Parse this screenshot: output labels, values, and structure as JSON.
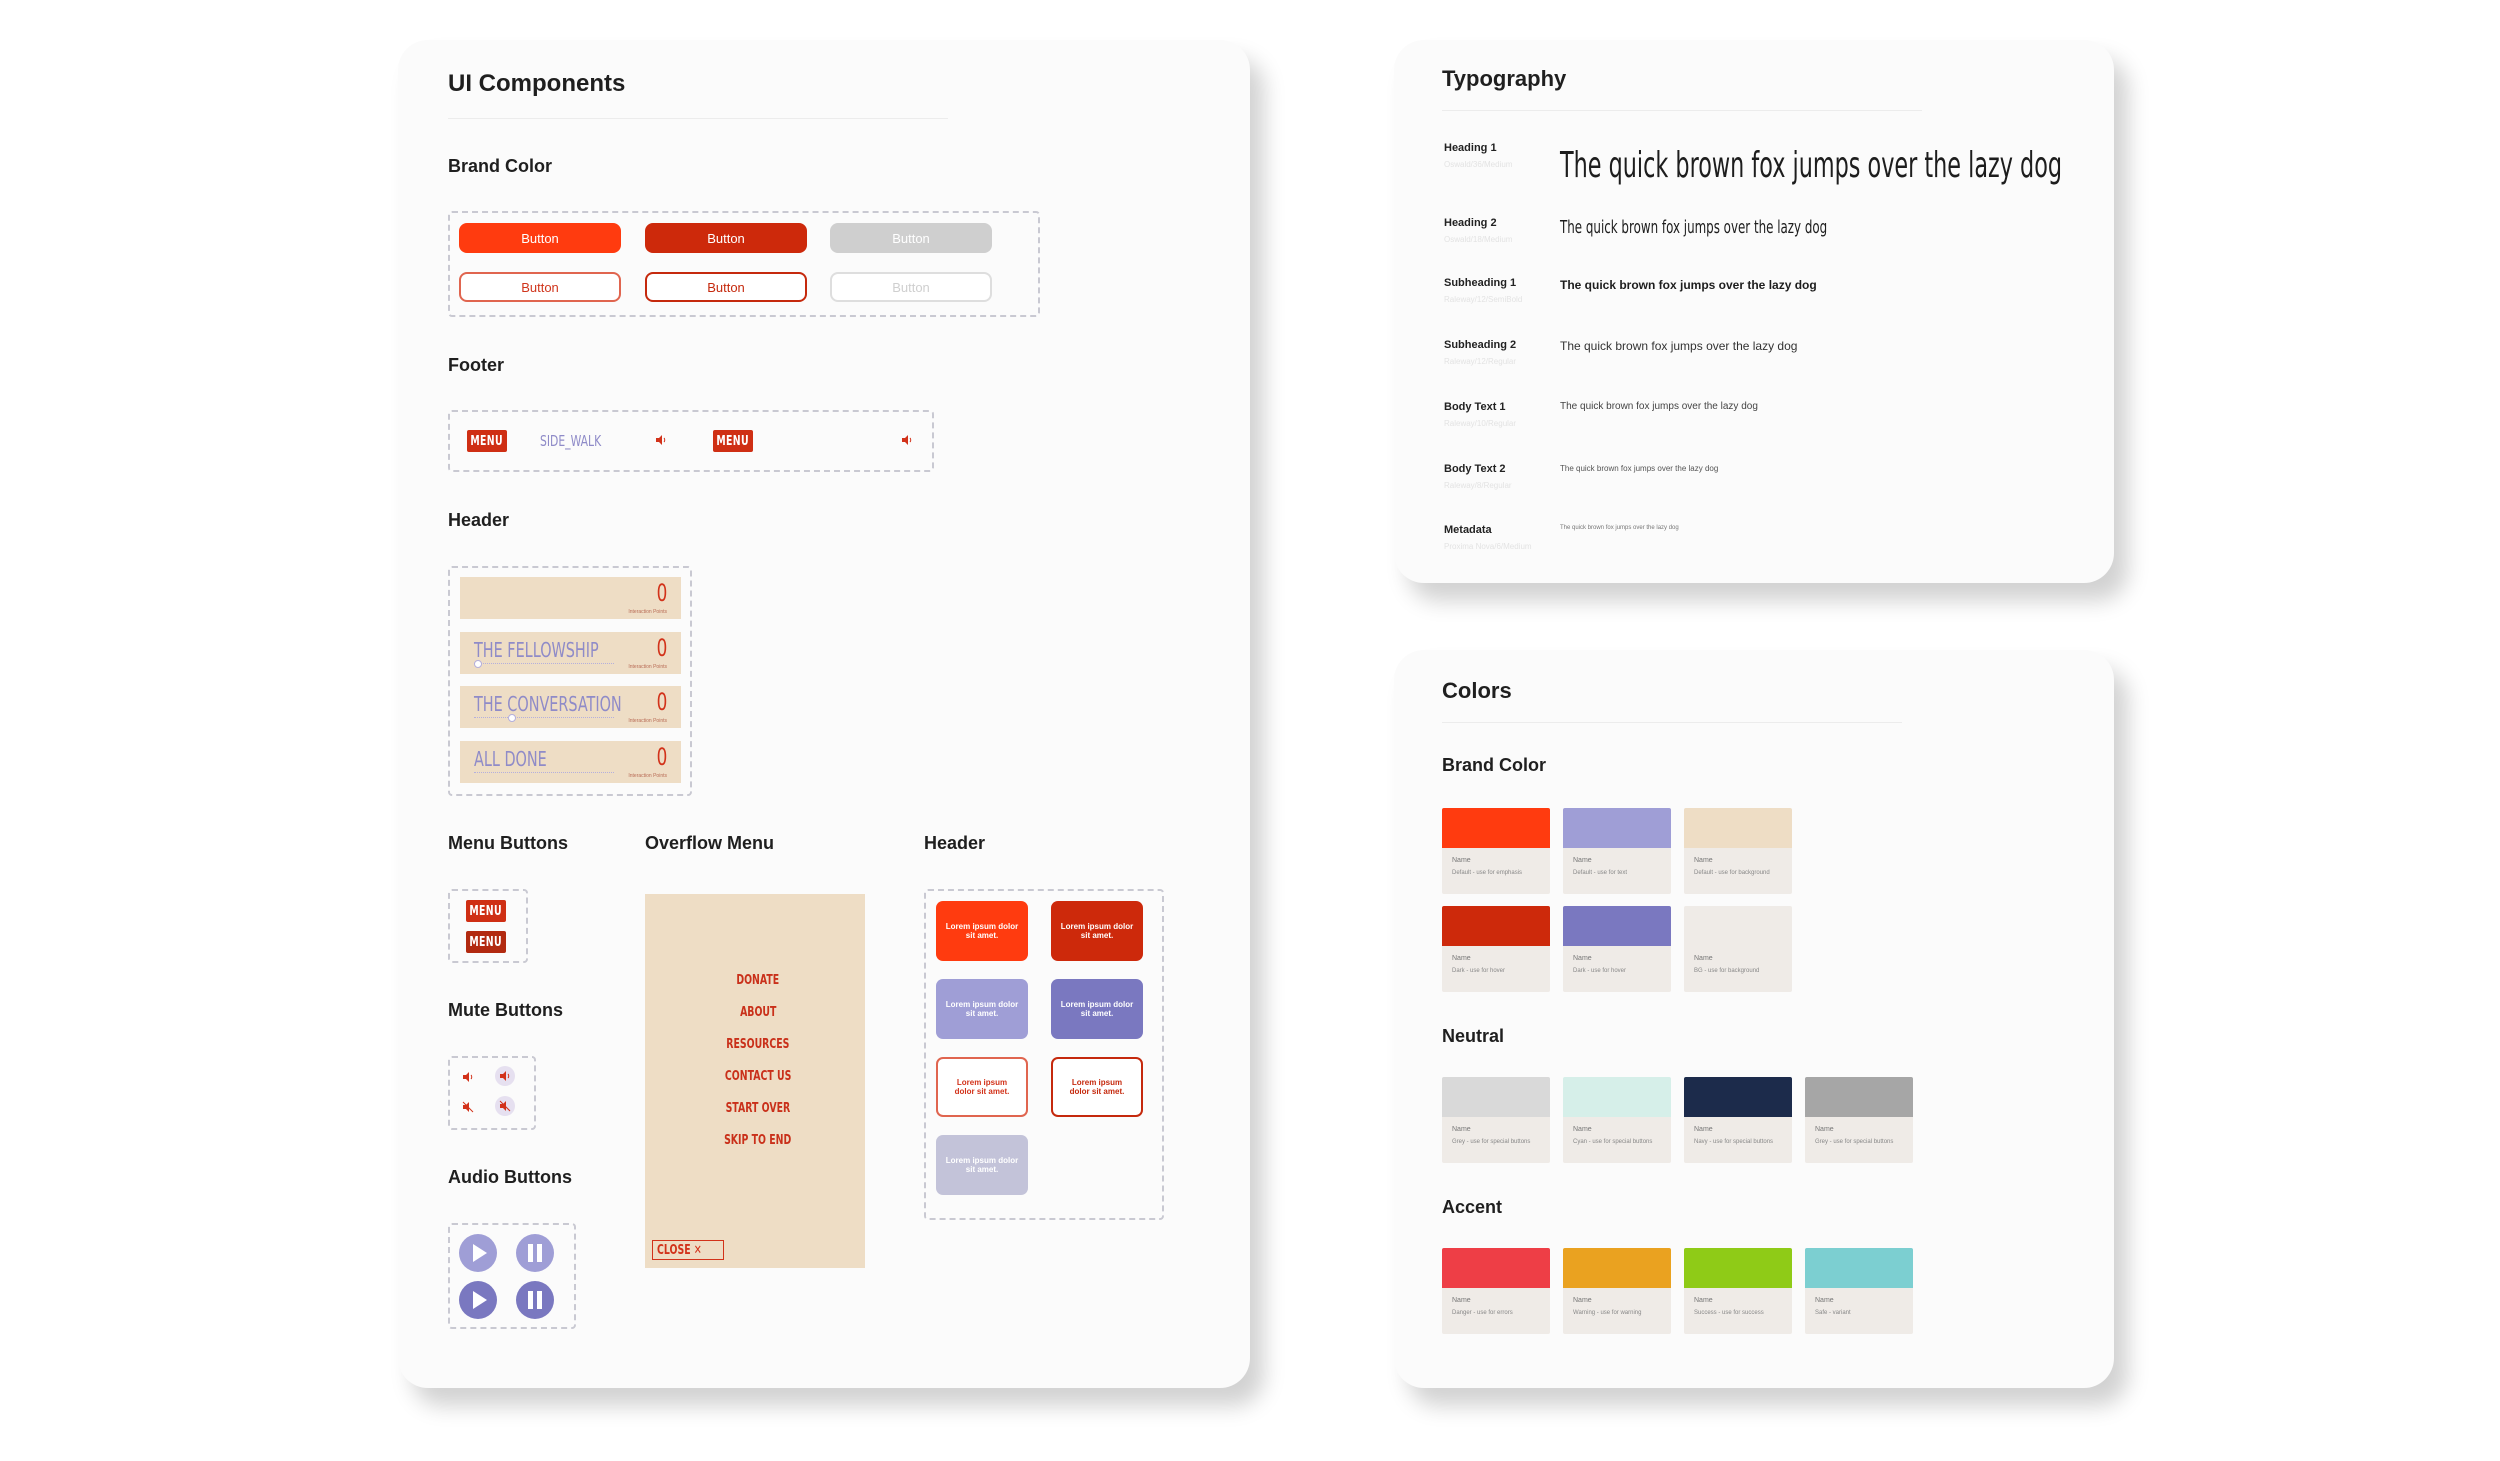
{
  "ui_components": {
    "title": "UI Components",
    "brand_color_label": "Brand Color",
    "button_label": "Button",
    "footer_label": "Footer",
    "footer_menu": "MENU",
    "footer_side": "SIDE_WALK",
    "header_label": "Header",
    "header_rows": [
      {
        "title": "",
        "points": "0",
        "sub": "Interaction Points"
      },
      {
        "title": "THE FELLOWSHIP",
        "points": "0",
        "sub": "Interaction Points"
      },
      {
        "title": "THE CONVERSATION",
        "points": "0",
        "sub": "Interaction Points"
      },
      {
        "title": "ALL DONE",
        "points": "0",
        "sub": "Interaction Points"
      }
    ],
    "menu_buttons_label": "Menu Buttons",
    "menu_label": "MENU",
    "mute_buttons_label": "Mute Buttons",
    "audio_buttons_label": "Audio Buttons",
    "overflow_menu_label": "Overflow Menu",
    "overflow_items": [
      "DONATE",
      "ABOUT",
      "RESOURCES",
      "CONTACT US",
      "START OVER",
      "SKIP TO END"
    ],
    "close_label": "CLOSE ✕",
    "header2_label": "Header",
    "tile_text": "Lorem ipsum dolor sit amet."
  },
  "typography": {
    "title": "Typography",
    "rows": [
      {
        "label": "Heading 1",
        "sub": "Oswald/36/Medium",
        "sample": "The quick brown fox jumps over the lazy dog"
      },
      {
        "label": "Heading 2",
        "sub": "Oswald/18/Medium",
        "sample": "The quick brown fox jumps over the lazy dog"
      },
      {
        "label": "Subheading 1",
        "sub": "Raleway/12/SemiBold",
        "sample": "The quick brown fox jumps over the lazy dog"
      },
      {
        "label": "Subheading 2",
        "sub": "Raleway/12/Regular",
        "sample": "The quick brown fox jumps over the lazy dog"
      },
      {
        "label": "Body Text 1",
        "sub": "Raleway/10/Regular",
        "sample": "The quick brown fox jumps over the lazy dog"
      },
      {
        "label": "Body Text 2",
        "sub": "Raleway/8/Regular",
        "sample": "The quick brown fox jumps over the lazy dog"
      },
      {
        "label": "Metadata",
        "sub": "Proxima Nova/6/Medium",
        "sample": "The quick brown fox jumps over the lazy dog"
      }
    ]
  },
  "colors": {
    "title": "Colors",
    "brand_label": "Brand Color",
    "neutral_label": "Neutral",
    "accent_label": "Accent",
    "name_label": "Name",
    "brand": [
      {
        "color": "#ff3b0f",
        "desc": "Default - use for emphasis"
      },
      {
        "color": "#9f9ed6",
        "desc": "Default - use for text"
      },
      {
        "color": "#eeddc5",
        "desc": "Default - use for background"
      },
      {
        "color": "#cd290b",
        "desc": "Dark - use for hover"
      },
      {
        "color": "#7a78c0",
        "desc": "Dark - use for hover"
      },
      {
        "color": "#efebe7",
        "desc": "BG - use for background"
      }
    ],
    "neutral": [
      {
        "color": "#d9d9d9",
        "desc": "Grey - use for special buttons"
      },
      {
        "color": "#d6efe9",
        "desc": "Cyan - use for special buttons"
      },
      {
        "color": "#1c2b4b",
        "desc": "Navy - use for special buttons"
      },
      {
        "color": "#a6a6a6",
        "desc": "Grey - use for special buttons"
      }
    ],
    "accent": [
      {
        "color": "#ee3e46",
        "desc": "Danger - use for errors"
      },
      {
        "color": "#eaa220",
        "desc": "Warning - use for warning"
      },
      {
        "color": "#8fcb17",
        "desc": "Success - use for success"
      },
      {
        "color": "#7ccfd1",
        "desc": "Safe - variant"
      }
    ]
  }
}
